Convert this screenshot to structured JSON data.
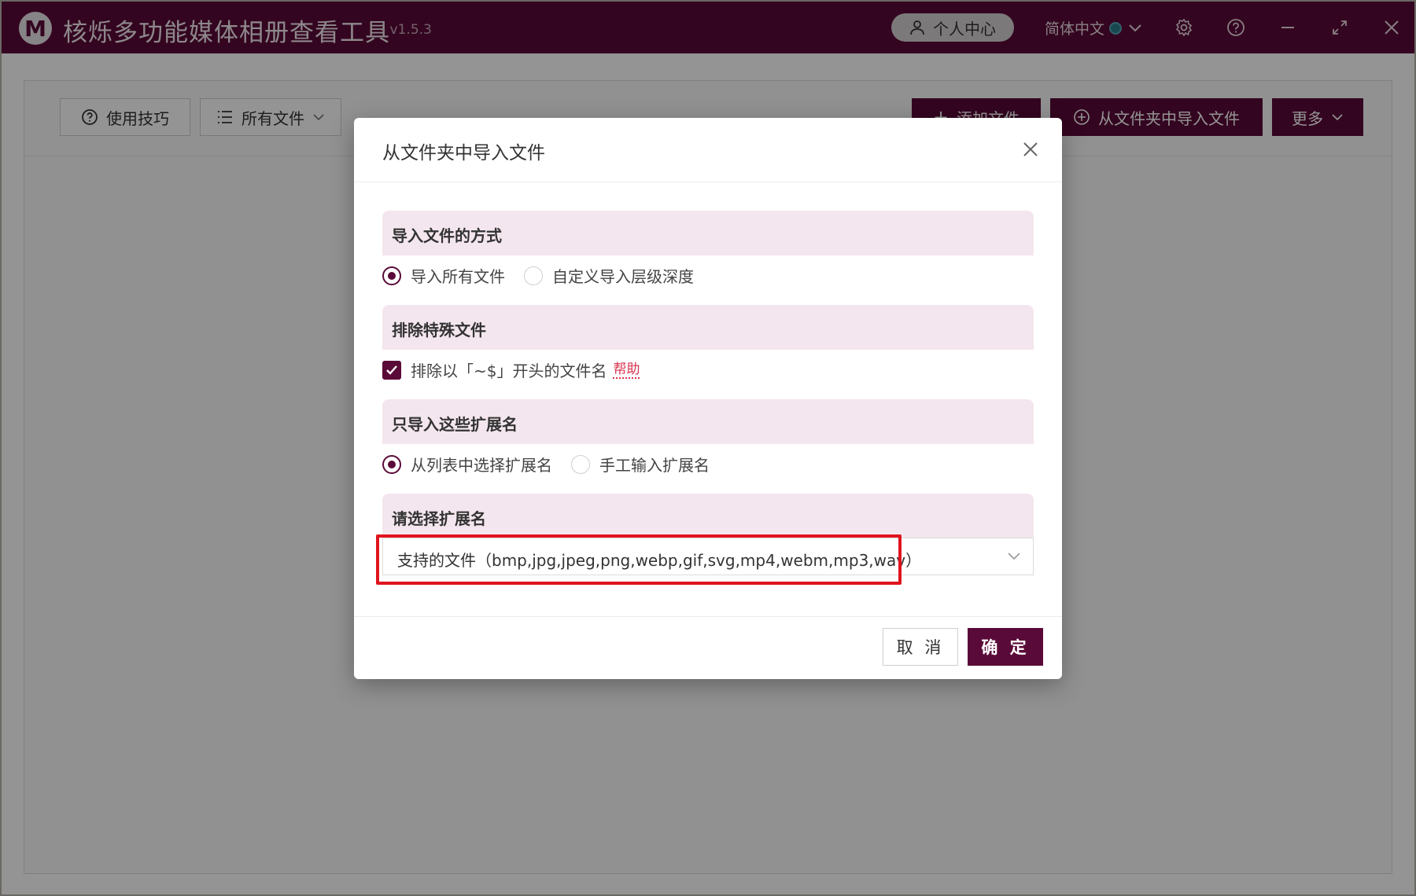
{
  "app": {
    "title": "核烁多功能媒体相册查看工具",
    "version": "- v1.5.3",
    "logo_letter": "M",
    "user_center": "个人中心",
    "language": "简体中文",
    "brand_color": "#5a0a38"
  },
  "toolbar": {
    "tips_label": "使用技巧",
    "filter_label": "所有文件",
    "add_files_label": "添加文件",
    "import_folder_label": "从文件夹中导入文件",
    "more_label": "更多"
  },
  "dialog": {
    "title": "从文件夹中导入文件",
    "sections": {
      "import_mode": {
        "heading": "导入文件的方式",
        "options": [
          "导入所有文件",
          "自定义导入层级深度"
        ],
        "selected": 0
      },
      "exclude": {
        "heading": "排除特殊文件",
        "checkbox_label": "排除以「~$」开头的文件名",
        "checked": true,
        "help_label": "帮助"
      },
      "ext_mode": {
        "heading": "只导入这些扩展名",
        "options": [
          "从列表中选择扩展名",
          "手工输入扩展名"
        ],
        "selected": 0
      },
      "ext_select": {
        "heading": "请选择扩展名",
        "value": "支持的文件（bmp,jpg,jpeg,png,webp,gif,svg,mp4,webm,mp3,wav）"
      }
    },
    "cancel_label": "取 消",
    "ok_label": "确 定"
  }
}
